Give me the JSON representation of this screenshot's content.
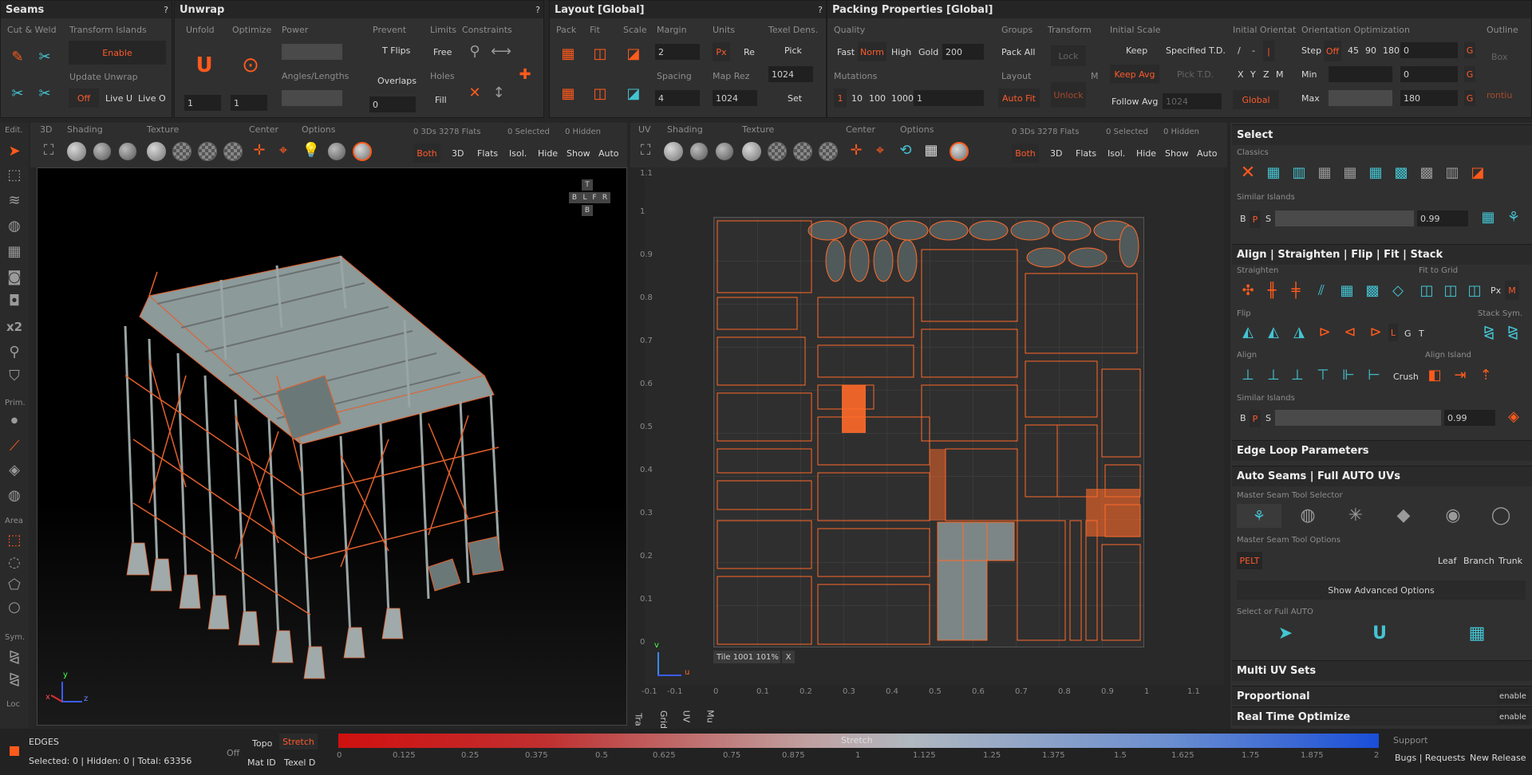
{
  "seams": {
    "title": "Seams",
    "cut_weld": "Cut & Weld",
    "transform_islands": "Transform Islands",
    "enable": "Enable",
    "update_unwrap": "Update Unwrap",
    "off": "Off",
    "live_u": "Live U",
    "live_o": "Live O"
  },
  "unwrap": {
    "title": "Unwrap",
    "unfold": "Unfold",
    "optimize": "Optimize",
    "power": "Power",
    "angles_lengths": "Angles/Lengths",
    "unfold_val": "1",
    "optimize_val": "1",
    "prevent": "Prevent",
    "t_flips": "T Flips",
    "overlaps": "Overlaps",
    "prevent_val": "0",
    "limits": "Limits",
    "free": "Free",
    "holes": "Holes",
    "fill": "Fill",
    "constraints": "Constraints"
  },
  "layout": {
    "title": "Layout [Global]",
    "pack": "Pack",
    "fit": "Fit",
    "scale": "Scale",
    "margin": "Margin",
    "margin_val": "2",
    "spacing": "Spacing",
    "spacing_val": "4",
    "units": "Units",
    "px": "Px",
    "re": "Re",
    "map_rez": "Map Rez",
    "map_rez_val": "1024",
    "texel_dens": "Texel Dens.",
    "pick": "Pick",
    "texel_val": "1024",
    "set": "Set"
  },
  "packing": {
    "title": "Packing Properties [Global]",
    "quality": "Quality",
    "fast": "Fast",
    "norm": "Norm",
    "high": "High",
    "gold": "Gold",
    "gold_val": "200",
    "mutations": "Mutations",
    "m1": "1",
    "m10": "10",
    "m100": "100",
    "m1000": "1000",
    "mut_val": "1",
    "groups": "Groups",
    "pack_all": "Pack All",
    "layout": "Layout",
    "auto_fit": "Auto Fit",
    "transform": "Transform",
    "lock": "Lock",
    "m": "M",
    "unlock": "Unlock",
    "initial_scale": "Initial Scale",
    "keep": "Keep",
    "specified_td": "Specified T.D.",
    "keep_avg": "Keep Avg",
    "pick_td": "Pick T.D.",
    "follow_avg": "Follow Avg",
    "follow_val": "1024",
    "initial_orient": "Initial Orientat",
    "slash": "/",
    "dash": "-",
    "pipe": "|",
    "x": "X",
    "y": "Y",
    "z": "Z",
    "global": "Global",
    "orient_opt": "Orientation Optimization",
    "step": "Step",
    "step_off": "Off",
    "s45": "45",
    "s90": "90",
    "s180": "180",
    "step_val": "0",
    "g": "G",
    "min": "Min",
    "min_val": "0",
    "max": "Max",
    "max_val": "180",
    "outline": "Outline",
    "box": "Box",
    "contour": "rontiu"
  },
  "left_toolbar": {
    "edit": "Edit.",
    "prim": "Prim.",
    "area": "Area",
    "sym": "Sym.",
    "loc": "Loc",
    "x2": "x2"
  },
  "viewport3d": {
    "tab": "3D",
    "shading": "Shading",
    "texture": "Texture",
    "center": "Center",
    "options": "Options",
    "stats": "0 3Ds 3278 Flats",
    "selected": "0 Selected",
    "hidden": "0 Hidden",
    "both": "Both",
    "v3d": "3D",
    "flats": "Flats",
    "isol": "Isol.",
    "hide": "Hide",
    "show": "Show",
    "auto": "Auto",
    "cube_t": "T",
    "cube_b": "B",
    "cube_l": "L",
    "cube_f": "F",
    "cube_r": "R",
    "cube_bot": "B",
    "axis_x": "x",
    "axis_y": "y",
    "axis_z": "z"
  },
  "viewportuv": {
    "tab": "UV",
    "shading": "Shading",
    "texture": "Texture",
    "center": "Center",
    "options": "Options",
    "stats": "0 3Ds 3278 Flats",
    "selected": "0 Selected",
    "hidden": "0 Hidden",
    "both": "Both",
    "v3d": "3D",
    "flats": "Flats",
    "isol": "Isol.",
    "hide": "Hide",
    "show": "Show",
    "auto": "Auto",
    "tile": "Tile 1001 101%",
    "tile_x": "X",
    "v_ticks": [
      "1.1",
      "1",
      "0.9",
      "0.8",
      "0.7",
      "0.6",
      "0.5",
      "0.4",
      "0.3",
      "0.2",
      "0.1",
      "0"
    ],
    "u_ticks": [
      "-0.1",
      "-0.1",
      "0",
      "0.1",
      "0.2",
      "0.3",
      "0.4",
      "0.5",
      "0.6",
      "0.7",
      "0.8",
      "0.9",
      "1",
      "1.1"
    ],
    "bottom_tabs": [
      "Tra",
      "Grid",
      "UV",
      "Mu"
    ],
    "axis_u": "u",
    "axis_v": "v"
  },
  "right": {
    "select": "Select",
    "classics": "Classics",
    "similar_islands": "Similar Islands",
    "b": "B",
    "p": "P",
    "s": "S",
    "sim_val": "0.99",
    "align_title": "Align | Straighten | Flip | Fit | Stack",
    "straighten": "Straighten",
    "fit_to_grid": "Fit to Grid",
    "px": "Px",
    "m": "M",
    "flip": "Flip",
    "l": "L",
    "g": "G",
    "t": "T",
    "stack_sym": "Stack Sym.",
    "align": "Align",
    "crush": "Crush",
    "align_island": "Align Island",
    "similar_islands2": "Similar Islands",
    "sim_val2": "0.99",
    "edge_loop": "Edge Loop Parameters",
    "auto_seams": "Auto Seams | Full AUTO UVs",
    "master_selector": "Master Seam Tool Selector",
    "master_options": "Master Seam Tool Options",
    "pelt": "PELT",
    "leaf": "Leaf",
    "branch": "Branch",
    "trunk": "Trunk",
    "show_adv": "Show Advanced Options",
    "select_full_auto": "Select or Full AUTO",
    "multi_uv": "Multi UV Sets",
    "proportional": "Proportional",
    "proportional_val": "enable",
    "realtime": "Real Time Optimize",
    "realtime_val": "enable"
  },
  "status": {
    "mode": "EDGES",
    "counts": "Selected: 0 | Hidden: 0 | Total: 63356",
    "off": "Off",
    "topo": "Topo",
    "stretch": "Stretch",
    "mat_id": "Mat ID",
    "texel_d": "Texel D",
    "bar_label": "Stretch",
    "ticks": [
      "0",
      "0.125",
      "0.25",
      "0.375",
      "0.5",
      "0.625",
      "0.75",
      "0.875",
      "1",
      "1.125",
      "1.25",
      "1.375",
      "1.5",
      "1.625",
      "1.75",
      "1.875",
      "2"
    ],
    "support": "Support",
    "bugs": "Bugs | Requests",
    "new_release": "New Release"
  },
  "colors": {
    "accent": "#ff5a1c",
    "cyan": "#44c4d2",
    "panel": "#303030"
  }
}
